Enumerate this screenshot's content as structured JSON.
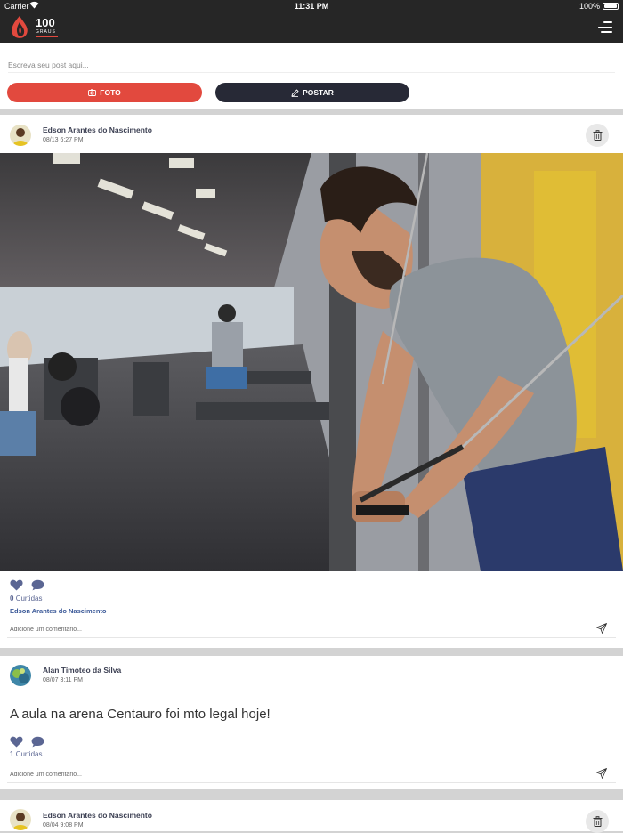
{
  "status_bar": {
    "carrier": "Carrier",
    "time": "11:31 PM",
    "battery": "100%"
  },
  "header": {
    "logo_text": "100",
    "logo_subtext": "GRAUS",
    "menu_icon": "hamburger-menu-icon"
  },
  "composer": {
    "placeholder": "Escreva seu post aqui...",
    "photo_button": "FOTO",
    "post_button": "POSTAR",
    "photo_color": "#e2493e",
    "post_color": "#272936"
  },
  "posts": [
    {
      "author": "Edson Arantes do Nascimento",
      "date": "08/13 6:27 PM",
      "image": "gym-man-cable-crossover",
      "likes_count": "0",
      "likes_label": "Curtidas",
      "liker": "Edson Arantes do Nascimento",
      "comment_placeholder": "Adicione um comentário..."
    },
    {
      "author": "Alan Timoteo da Silva",
      "date": "08/07 3:11 PM",
      "text": "A aula na arena Centauro foi mto legal hoje!",
      "likes_count": "1",
      "likes_label": "Curtidas",
      "comment_placeholder": "Adicione um comentário..."
    },
    {
      "author": "Edson Arantes do Nascimento",
      "date": "08/04 9:08 PM"
    }
  ],
  "colors": {
    "accent_red": "#e2493e",
    "dark": "#262626",
    "link_blue": "#5b6693"
  }
}
